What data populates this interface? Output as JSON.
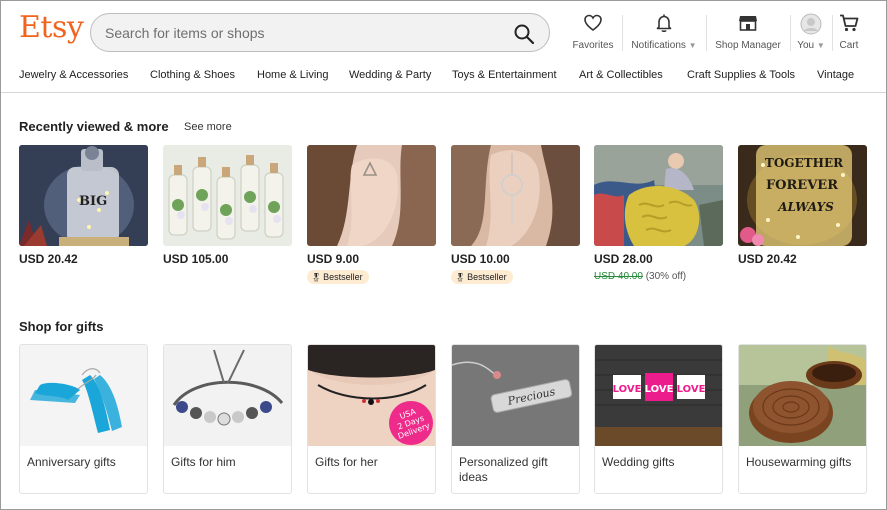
{
  "header": {
    "logo": "Etsy",
    "search_placeholder": "Search for items or shops",
    "nav": {
      "favorites": "Favorites",
      "notifications": "Notifications",
      "shop_manager": "Shop Manager",
      "you": "You",
      "cart": "Cart"
    }
  },
  "categories": [
    "Jewelry & Accessories",
    "Clothing & Shoes",
    "Home & Living",
    "Wedding & Party",
    "Toys & Entertainment",
    "Art & Collectibles",
    "Craft Supplies & Tools",
    "Vintage"
  ],
  "recently_viewed": {
    "title": "Recently viewed & more",
    "see_more": "See more",
    "items": [
      {
        "price": "USD 20.42"
      },
      {
        "price": "USD 105.00"
      },
      {
        "price": "USD 9.00",
        "badge": "Bestseller"
      },
      {
        "price": "USD 10.00",
        "badge": "Bestseller"
      },
      {
        "price": "USD 28.00",
        "original_price": "USD 40.00",
        "discount": "(30% off)"
      },
      {
        "price": "USD 20.42"
      }
    ]
  },
  "gifts": {
    "title": "Shop for gifts",
    "items": [
      {
        "label": "Anniversary gifts"
      },
      {
        "label": "Gifts for him"
      },
      {
        "label": "Gifts for her",
        "image_text": [
          "USA",
          "2 Days",
          "Delivery"
        ]
      },
      {
        "label": "Personalized gift ideas",
        "image_text": [
          "Precious"
        ]
      },
      {
        "label": "Wedding gifts",
        "image_text": [
          "LOVE",
          "LOVE",
          "LOVE"
        ]
      },
      {
        "label": "Housewarming gifts"
      }
    ]
  },
  "image_text": {
    "bottle_big": "BIG",
    "bottle_together": [
      "TOGETHER",
      "FOREVER",
      "ALWAYS"
    ]
  },
  "colors": {
    "brand": "#f1641e",
    "bestseller_bg": "#fdebd2",
    "sale_green": "#2a8a3c"
  }
}
